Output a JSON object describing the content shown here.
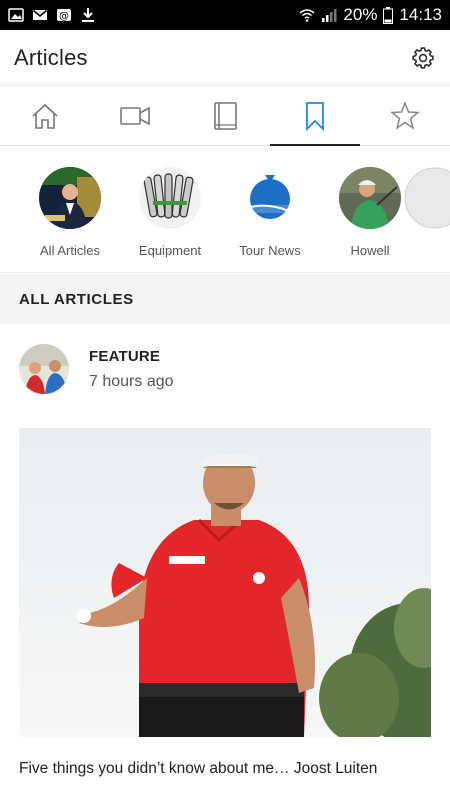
{
  "status_bar": {
    "battery": "20%",
    "time": "14:13"
  },
  "app_bar": {
    "title": "Articles",
    "settings_icon": "gear-icon"
  },
  "tabs": [
    {
      "icon": "home-icon",
      "active": false
    },
    {
      "icon": "video-icon",
      "active": false
    },
    {
      "icon": "book-icon",
      "active": false
    },
    {
      "icon": "bookmark-icon",
      "active": true
    },
    {
      "icon": "star-icon",
      "active": false
    }
  ],
  "categories": [
    {
      "label": "All Articles"
    },
    {
      "label": "Equipment"
    },
    {
      "label": "Tour News"
    },
    {
      "label": "Howell"
    }
  ],
  "section": {
    "title": "ALL ARTICLES"
  },
  "article": {
    "kind": "FEATURE",
    "time": "7 hours ago",
    "headline": "Five things you didn’t know about me… Joost Luiten"
  },
  "colors": {
    "accent": "#1e88e5",
    "text": "#222222",
    "muted": "#555555",
    "section_bg": "#f4f4f4"
  }
}
